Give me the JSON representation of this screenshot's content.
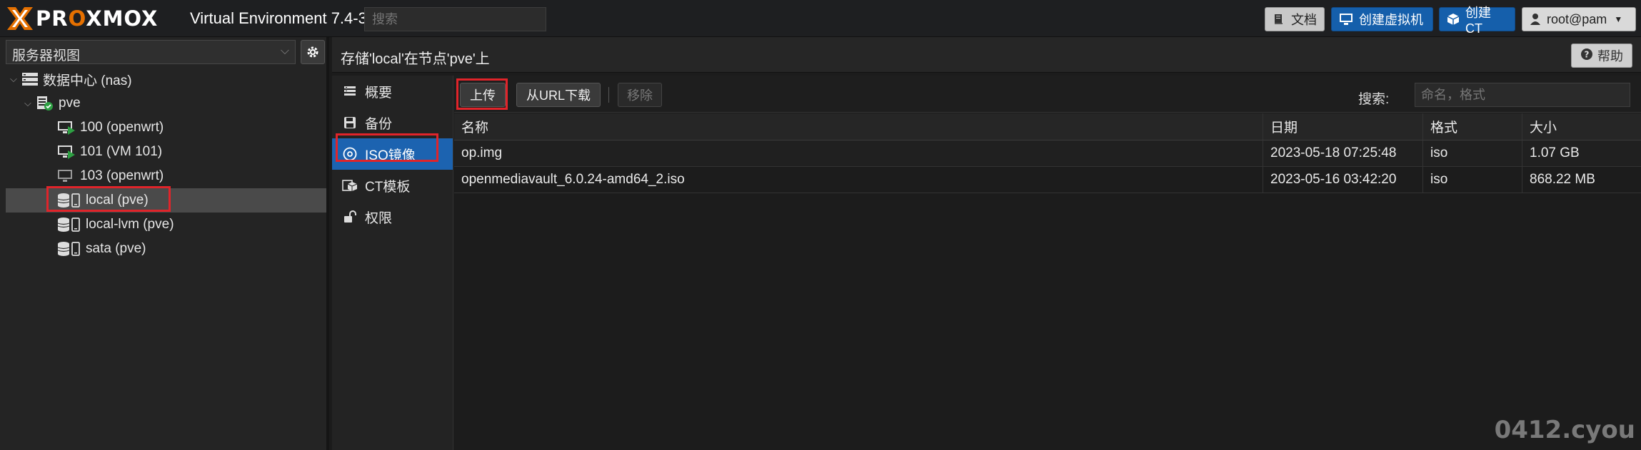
{
  "topbar": {
    "logo_text_prefix": "PR",
    "logo_text_o": "O",
    "logo_text_suffix": "XMOX",
    "version": "Virtual Environment 7.4-3",
    "search_placeholder": "搜索",
    "docs_label": "文档",
    "create_vm_label": "创建虚拟机",
    "create_ct_label": "创建CT",
    "user_label": "root@pam"
  },
  "left": {
    "view_select": "服务器视图",
    "tree": [
      {
        "label": "数据中心 (nas)",
        "icon": "datacenter-icon"
      },
      {
        "label": "pve",
        "icon": "node-online-icon"
      },
      {
        "label": "100 (openwrt)",
        "icon": "vm-running-icon"
      },
      {
        "label": "101 (VM 101)",
        "icon": "vm-running-icon"
      },
      {
        "label": "103 (openwrt)",
        "icon": "vm-stopped-icon"
      },
      {
        "label": "local (pve)",
        "icon": "storage-icon"
      },
      {
        "label": "local-lvm (pve)",
        "icon": "storage-icon"
      },
      {
        "label": "sata (pve)",
        "icon": "storage-icon"
      }
    ]
  },
  "content": {
    "title": "存储'local'在节点'pve'上",
    "help_label": "帮助",
    "subnav": [
      {
        "label": "概要",
        "icon": "summary-icon"
      },
      {
        "label": "备份",
        "icon": "backup-floppy-icon"
      },
      {
        "label": "ISO镜像",
        "icon": "iso-disc-icon"
      },
      {
        "label": "CT模板",
        "icon": "ct-template-icon"
      },
      {
        "label": "权限",
        "icon": "permissions-lock-icon"
      }
    ],
    "toolbar": {
      "upload_label": "上传",
      "download_url_label": "从URL下载",
      "remove_label": "移除",
      "search_label": "搜索:",
      "search_placeholder": "命名，格式"
    },
    "columns": {
      "name": "名称",
      "date": "日期",
      "format": "格式",
      "size": "大小"
    },
    "rows": [
      {
        "name": "op.img",
        "date": "2023-05-18 07:25:48",
        "format": "iso",
        "size": "1.07 GB"
      },
      {
        "name": "openmediavault_6.0.24-amd64_2.iso",
        "date": "2023-05-16 03:42:20",
        "format": "iso",
        "size": "868.22 MB"
      }
    ]
  },
  "watermark": "0412.cyou",
  "colors": {
    "accent": "#1c63b0",
    "highlight": "#e0242a",
    "brand_orange": "#e57000"
  }
}
